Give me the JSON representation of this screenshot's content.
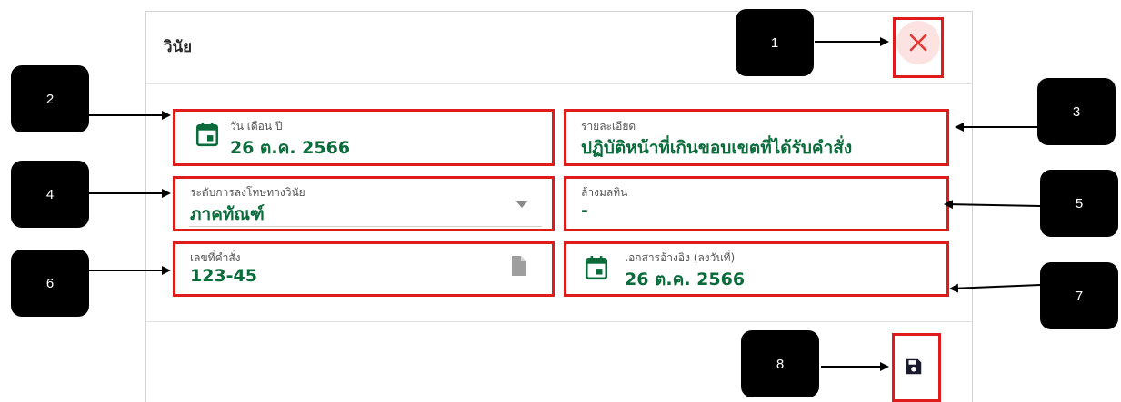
{
  "dialog": {
    "title": "วินัย",
    "close_icon": "close-icon",
    "save_icon": "floppy-disk-icon",
    "accent_color": "#0a6b3b",
    "close_color": "#e53935"
  },
  "fields": {
    "date": {
      "label": "วัน เดือน ปี",
      "value": "26 ต.ค. 2566",
      "icon": "calendar-icon"
    },
    "detail": {
      "label": "รายละเอียด",
      "value": "ปฏิบัติหน้าที่เกินขอบเขตที่ได้รับคำสั่ง"
    },
    "penalty": {
      "label": "ระดับการลงโทษทางวินัย",
      "value": "ภาคทัณฑ์",
      "icon": "dropdown-caret-icon"
    },
    "clear": {
      "label": "ล้างมลทิน",
      "value": "-"
    },
    "order_no": {
      "label": "เลขที่คำสั่ง",
      "value": "123-45",
      "icon": "document-icon"
    },
    "ref_doc": {
      "label": "เอกสารอ้างอิง (ลงวันที่)",
      "value": "26 ต.ค. 2566",
      "icon": "calendar-icon"
    }
  },
  "callouts": [
    "1",
    "2",
    "3",
    "4",
    "5",
    "6",
    "7",
    "8"
  ],
  "annotation_color": "#e01b1b"
}
